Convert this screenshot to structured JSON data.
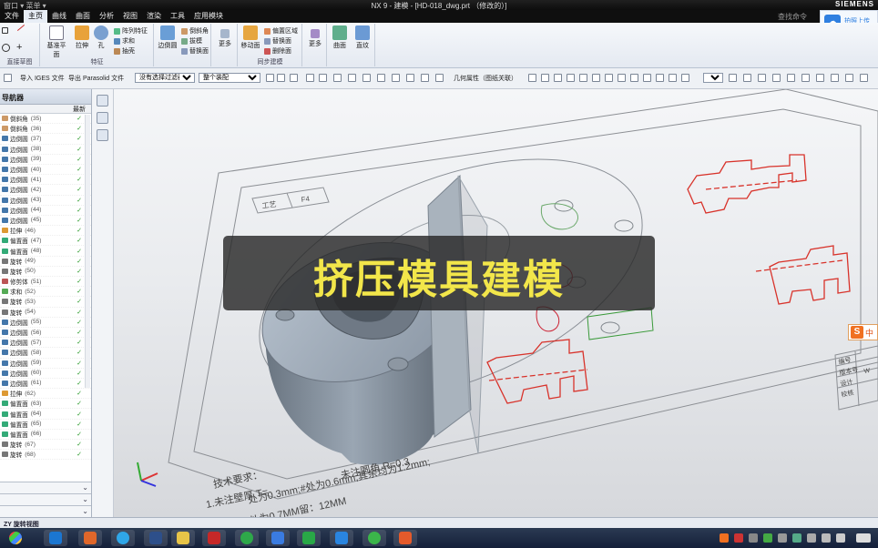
{
  "titlebar": {
    "title": "NX 9 - 建模 - [HD-018_dwg.prt （修改的）]",
    "brand": "SIEMENS",
    "quick_menu": "窗口 ▾ 菜单 ▾"
  },
  "menubar": {
    "items": [
      "文件",
      "主页",
      "曲线",
      "曲面",
      "分析",
      "视图",
      "渲染",
      "工具",
      "应用模块"
    ],
    "active_index": 1,
    "search": "查找命令"
  },
  "cloud": {
    "label": "拍照上传"
  },
  "ribbon": {
    "direct_sketch": {
      "label": "直接草图"
    },
    "feature": {
      "label": "特征",
      "buttons": [
        "基准平面",
        "拉伸",
        "孔"
      ],
      "small": [
        "阵列特征",
        "求和",
        "抽壳"
      ]
    },
    "edge": {
      "buttons": [
        "边倒圆"
      ],
      "small": [
        "倒斜角",
        "拔模",
        "替换面"
      ]
    },
    "more1": "更多",
    "sync": {
      "label": "同步建模",
      "buttons": [
        "移动面"
      ],
      "small": [
        "偏置区域",
        "替换面",
        "删除面"
      ]
    },
    "more2": "更多",
    "others": [
      "曲面",
      "直纹"
    ]
  },
  "toolbar": {
    "import": "导入 IGES 文件",
    "export": "导出 Parasolid 文件",
    "filter": "没有选择过滤器",
    "scope": "整个装配",
    "snap": "几何属性（图纸关联）"
  },
  "navigator": {
    "title": "导航器",
    "col_header": "最新",
    "rows": [
      {
        "name": "倒斜角",
        "num": "(35)",
        "color": "#c96"
      },
      {
        "name": "倒斜角",
        "num": "(36)",
        "color": "#c96"
      },
      {
        "name": "边倒圆",
        "num": "(37)",
        "color": "#47a"
      },
      {
        "name": "边倒圆",
        "num": "(38)",
        "color": "#47a"
      },
      {
        "name": "边倒圆",
        "num": "(39)",
        "color": "#47a"
      },
      {
        "name": "边倒圆",
        "num": "(40)",
        "color": "#47a"
      },
      {
        "name": "边倒圆",
        "num": "(41)",
        "color": "#47a"
      },
      {
        "name": "边倒圆",
        "num": "(42)",
        "color": "#47a"
      },
      {
        "name": "边倒圆",
        "num": "(43)",
        "color": "#47a"
      },
      {
        "name": "边倒圆",
        "num": "(44)",
        "color": "#47a"
      },
      {
        "name": "边倒圆",
        "num": "(45)",
        "color": "#47a"
      },
      {
        "name": "拉伸",
        "num": "(46)",
        "color": "#d93"
      },
      {
        "name": "偏置面",
        "num": "(47)",
        "color": "#3a7"
      },
      {
        "name": "偏置面",
        "num": "(48)",
        "color": "#3a7"
      },
      {
        "name": "旋转",
        "num": "(49)",
        "color": "#777"
      },
      {
        "name": "旋转",
        "num": "(50)",
        "color": "#777"
      },
      {
        "name": "修剪体",
        "num": "(51)",
        "color": "#b55"
      },
      {
        "name": "求和",
        "num": "(52)",
        "color": "#5a5"
      },
      {
        "name": "旋转",
        "num": "(53)",
        "color": "#777"
      },
      {
        "name": "旋转",
        "num": "(54)",
        "color": "#777"
      },
      {
        "name": "边倒圆",
        "num": "(55)",
        "color": "#47a"
      },
      {
        "name": "边倒圆",
        "num": "(56)",
        "color": "#47a"
      },
      {
        "name": "边倒圆",
        "num": "(57)",
        "color": "#47a"
      },
      {
        "name": "边倒圆",
        "num": "(58)",
        "color": "#47a"
      },
      {
        "name": "边倒圆",
        "num": "(59)",
        "color": "#47a"
      },
      {
        "name": "边倒圆",
        "num": "(60)",
        "color": "#47a"
      },
      {
        "name": "边倒圆",
        "num": "(61)",
        "color": "#47a"
      },
      {
        "name": "拉伸",
        "num": "(62)",
        "color": "#d93"
      },
      {
        "name": "偏置面",
        "num": "(63)",
        "color": "#3a7"
      },
      {
        "name": "偏置面",
        "num": "(64)",
        "color": "#3a7"
      },
      {
        "name": "偏置面",
        "num": "(65)",
        "color": "#3a7"
      },
      {
        "name": "偏置面",
        "num": "(66)",
        "color": "#3a7"
      },
      {
        "name": "旋转",
        "num": "(67)",
        "color": "#777"
      },
      {
        "name": "旋转",
        "num": "(68)",
        "color": "#777"
      }
    ]
  },
  "statusbar": {
    "text": "ZY 旋转视图"
  },
  "viewport": {
    "overlay_caption": "挤压模具建模",
    "drawing": {
      "title_cell_1": "工艺",
      "title_cell_2": "F4",
      "tech_heading": "技术要求：",
      "tech_line_1": "1.未注壁厚 T=",
      "tech_line_2": "处为0.3mm;#处为0.6mm;其余均为1.2mm;",
      "tech_line_3": "处为0.7MM留：12MM",
      "tech_line_4": "未注圆角 R=0.3",
      "table_rows": [
        "编号",
        "版本号",
        "设计",
        "校核"
      ],
      "table_val": "W"
    },
    "sogou": "中"
  },
  "colors": {
    "accent": "#2f7fe0",
    "overlay_text": "#f2e64a",
    "sketch_red": "#d8322a",
    "part_gray": "#8e9aa6"
  }
}
